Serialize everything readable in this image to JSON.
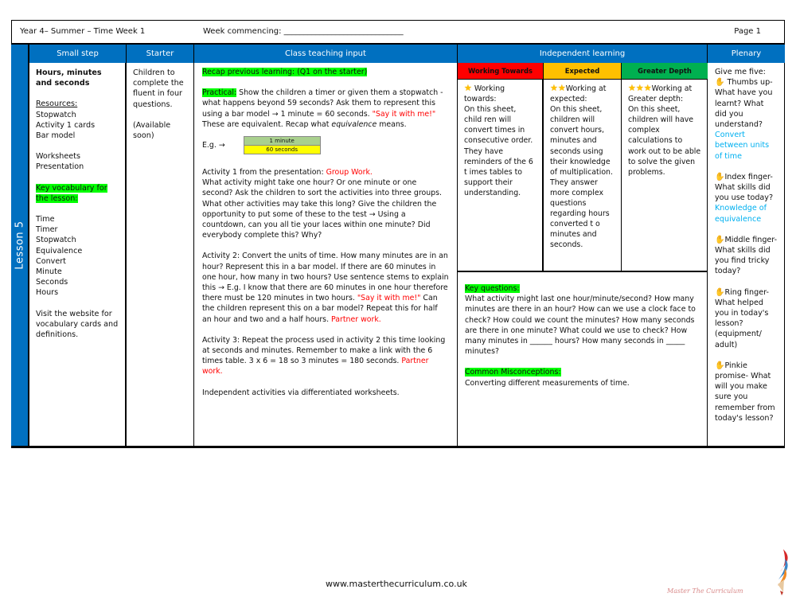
{
  "header": {
    "title": "Year 4– Summer – Time  Week 1",
    "week_commencing": "Week commencing: ______________________________",
    "page": "Page 1"
  },
  "lesson_label": "Lesson 5",
  "columns": {
    "small_step": "Small step",
    "starter": "Starter",
    "class_teaching": "Class teaching input",
    "independent": "Independent learning",
    "plenary": "Plenary"
  },
  "small_step": {
    "title": "Hours, minutes and seconds",
    "resources_label": "Resources:",
    "resources": [
      "Stopwatch",
      "Activity 1 cards",
      "Bar model"
    ],
    "resources2": [
      "Worksheets",
      "Presentation"
    ],
    "vocab_label": "Key vocabulary for the lesson:",
    "vocab": [
      "Time",
      "Timer",
      "Stopwatch",
      "Equivalence",
      "Convert",
      "Minute",
      "Seconds",
      "Hours"
    ],
    "website_note": "Visit the website for vocabulary cards and definitions."
  },
  "starter": {
    "text": "Children to complete the fluent in four questions.",
    "availability": "(Available soon)"
  },
  "class_teaching": {
    "recap": "Recap previous learning: (Q1 on the starter)",
    "practical_label": "Practical:",
    "practical_text": " Show the children a timer or given them a stopwatch - what happens beyond 59 seconds? Ask them to represent this using a bar model → 1 minute = 60 seconds. ",
    "say_it": "\"Say it with me!\"",
    "equiv_pre": "These are equivalent. Recap what ",
    "equiv_word": "equivalence",
    "equiv_post": " means.",
    "eg_label": "E.g. →",
    "bar_top": "1 minute",
    "bar_bottom": "60 seconds",
    "activity1_intro": "Activity 1 from the presentation: ",
    "activity1_mode": "Group Work.",
    "activity1_text": "What activity might take one hour? Or one minute or one second? Ask the children to sort the activities into three groups. What other activities may take this long? Give the children the opportunity to put some of these to the test → Using a countdown, can you all tie your laces within one minute? Did everybody complete this? Why?",
    "activity2_text": "Activity 2: Convert the units of time. How many minutes are in an hour? Represent this in a bar model. If there are 60 minutes in one hour, how many in two hours? Use sentence stems to explain this → E.g. I know that there are 60 minutes in one hour therefore there must be 120 minutes in two hours. ",
    "activity2_say": "\"Say it with me!\"",
    "activity2_text2": " Can the children represent this on a bar model? Repeat this for half an hour and two and a half hours. ",
    "activity2_mode": "Partner work.",
    "activity3_text": "Activity 3: Repeat the process used in activity 2 this time looking at seconds and minutes. Remember to make a link with the 6 times table. 3 x 6 = 18 so 3 minutes = 180 seconds. ",
    "activity3_mode": "Partner work.",
    "independent_note": "Independent activities via differentiated worksheets."
  },
  "independent": {
    "levels": [
      {
        "label": "Working Towards",
        "color": "#ff0000",
        "stars": "★",
        "text": " Working towards:\nOn this sheet, child ren will convert times in consecutive  order. They have reminders of the 6 t imes tables to support their understanding."
      },
      {
        "label": "Expected",
        "color": "#ffc000",
        "stars": "★★",
        "text": "Working at expected:\n On this sheet, children will convert hours, minutes and seconds using their knowledge of multiplication. They answer more complex questions regarding hours converted t o minutes and seconds."
      },
      {
        "label": "Greater Depth",
        "color": "#00b050",
        "stars": "★★★",
        "text": "Working at Greater depth:\nOn this sheet, children will have complex calculations to work out to be able to solve the given problems."
      }
    ],
    "key_questions_label": "Key questions:",
    "key_questions": "What activity might last one hour/minute/second? How many minutes are there in an hour? How can we use a clock face to check? How could we count the minutes? How many seconds are there in one minute? What could we use to check? How many minutes in ______ hours? How many seconds in _____ minutes?",
    "misconceptions_label": "Common Misconceptions:",
    "misconceptions": "Converting different measurements of time."
  },
  "plenary": {
    "intro": "Give me five:",
    "items": [
      {
        "icon": "hand-icon",
        "text": " Thumbs up- What have you learnt? What did you understand?",
        "answer": "Convert between units of time"
      },
      {
        "icon": "hand-icon",
        "text": "Index finger- What skills did you use today?",
        "answer": "Knowledge of equivalence"
      },
      {
        "icon": "hand-icon",
        "text": "Middle finger- What skills did you find tricky today?",
        "answer": ""
      },
      {
        "icon": "hand-icon",
        "text": "Ring finger- What helped you in today's lesson? (equipment/ adult)",
        "answer": ""
      },
      {
        "icon": "hand-icon",
        "text": "Pinkie promise- What will you make sure you remember from today's lesson?",
        "answer": ""
      }
    ]
  },
  "footer": {
    "url": "www.masterthecurriculum.co.uk",
    "logo_text": "Master  The  Curriculum"
  },
  "colors": {
    "header_blue": "#0070c0",
    "highlight_green": "#00ff00",
    "accent_red": "#ff0000",
    "accent_cyan": "#00b0f0"
  }
}
